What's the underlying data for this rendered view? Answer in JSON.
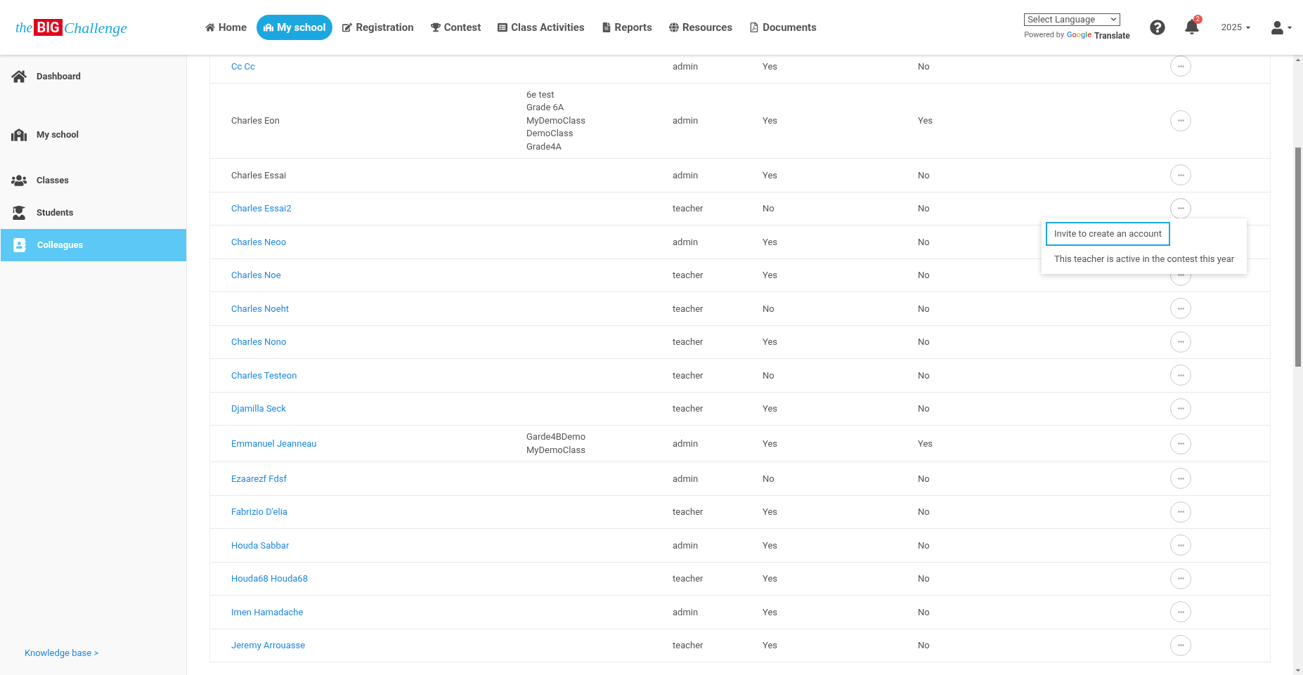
{
  "header": {
    "logo": {
      "prefix": "the",
      "badge": "BIG",
      "suffix": "Challenge"
    },
    "nav": [
      {
        "label": "Home",
        "selected": false
      },
      {
        "label": "My school",
        "selected": true
      },
      {
        "label": "Registration",
        "selected": false
      },
      {
        "label": "Contest",
        "selected": false
      },
      {
        "label": "Class Activities",
        "selected": false
      },
      {
        "label": "Reports",
        "selected": false
      },
      {
        "label": "Resources",
        "selected": false
      },
      {
        "label": "Documents",
        "selected": false
      }
    ],
    "language_select": {
      "value": "Select Language"
    },
    "powered_by": "Powered by",
    "google": "Google",
    "translate": "Translate",
    "notifications_count": "2",
    "year": "2025"
  },
  "sidebar": {
    "items": [
      {
        "label": "Dashboard",
        "selected": false
      },
      {
        "label": "My school",
        "selected": false
      },
      {
        "label": "Classes",
        "selected": false
      },
      {
        "label": "Students",
        "selected": false
      },
      {
        "label": "Colleagues",
        "selected": true
      }
    ],
    "knowledge_base": "Knowledge base >"
  },
  "table": {
    "rows": [
      {
        "name": "Cc Cc",
        "linked": true,
        "classes": [],
        "role": "admin",
        "column_4": "Yes",
        "column_5": "No"
      },
      {
        "name": "Charles Eon",
        "linked": false,
        "classes": [
          "6e test",
          "Grade 6A",
          "MyDemoClass",
          "DemoClass",
          "Grade4A"
        ],
        "role": "admin",
        "column_4": "Yes",
        "column_5": "Yes"
      },
      {
        "name": "Charles Essai",
        "linked": false,
        "classes": [],
        "role": "admin",
        "column_4": "Yes",
        "column_5": "No"
      },
      {
        "name": "Charles Essai2",
        "linked": true,
        "classes": [],
        "role": "teacher",
        "column_4": "No",
        "column_5": "No",
        "menu_open": true
      },
      {
        "name": "Charles Neoo",
        "linked": true,
        "classes": [],
        "role": "admin",
        "column_4": "Yes",
        "column_5": "No"
      },
      {
        "name": "Charles Noe",
        "linked": true,
        "classes": [],
        "role": "teacher",
        "column_4": "Yes",
        "column_5": "No"
      },
      {
        "name": "Charles Noeht",
        "linked": true,
        "classes": [],
        "role": "teacher",
        "column_4": "No",
        "column_5": "No"
      },
      {
        "name": "Charles Nono",
        "linked": true,
        "classes": [],
        "role": "teacher",
        "column_4": "Yes",
        "column_5": "No"
      },
      {
        "name": "Charles Testeon",
        "linked": true,
        "classes": [],
        "role": "teacher",
        "column_4": "No",
        "column_5": "No"
      },
      {
        "name": "Djamilla Seck",
        "linked": true,
        "classes": [],
        "role": "teacher",
        "column_4": "Yes",
        "column_5": "No"
      },
      {
        "name": "Emmanuel Jeanneau",
        "linked": true,
        "classes": [
          "Garde4BDemo",
          "MyDemoClass"
        ],
        "role": "admin",
        "column_4": "Yes",
        "column_5": "Yes"
      },
      {
        "name": "Ezaarezf Fdsf",
        "linked": true,
        "classes": [],
        "role": "admin",
        "column_4": "No",
        "column_5": "No"
      },
      {
        "name": "Fabrizio D'elia",
        "linked": true,
        "classes": [],
        "role": "teacher",
        "column_4": "Yes",
        "column_5": "No"
      },
      {
        "name": "Houda Sabbar",
        "linked": true,
        "classes": [],
        "role": "admin",
        "column_4": "Yes",
        "column_5": "No"
      },
      {
        "name": "Houda68 Houda68",
        "linked": true,
        "classes": [],
        "role": "teacher",
        "column_4": "Yes",
        "column_5": "No"
      },
      {
        "name": "Imen Hamadache",
        "linked": true,
        "classes": [],
        "role": "admin",
        "column_4": "Yes",
        "column_5": "No"
      },
      {
        "name": "Jeremy Arrouasse",
        "linked": true,
        "classes": [],
        "role": "teacher",
        "column_4": "Yes",
        "column_5": "No"
      }
    ]
  },
  "action_menu": {
    "items": [
      {
        "label": "Invite to create an account",
        "selected": true
      },
      {
        "label": "This teacher is active in the contest this year",
        "selected": false
      }
    ]
  }
}
